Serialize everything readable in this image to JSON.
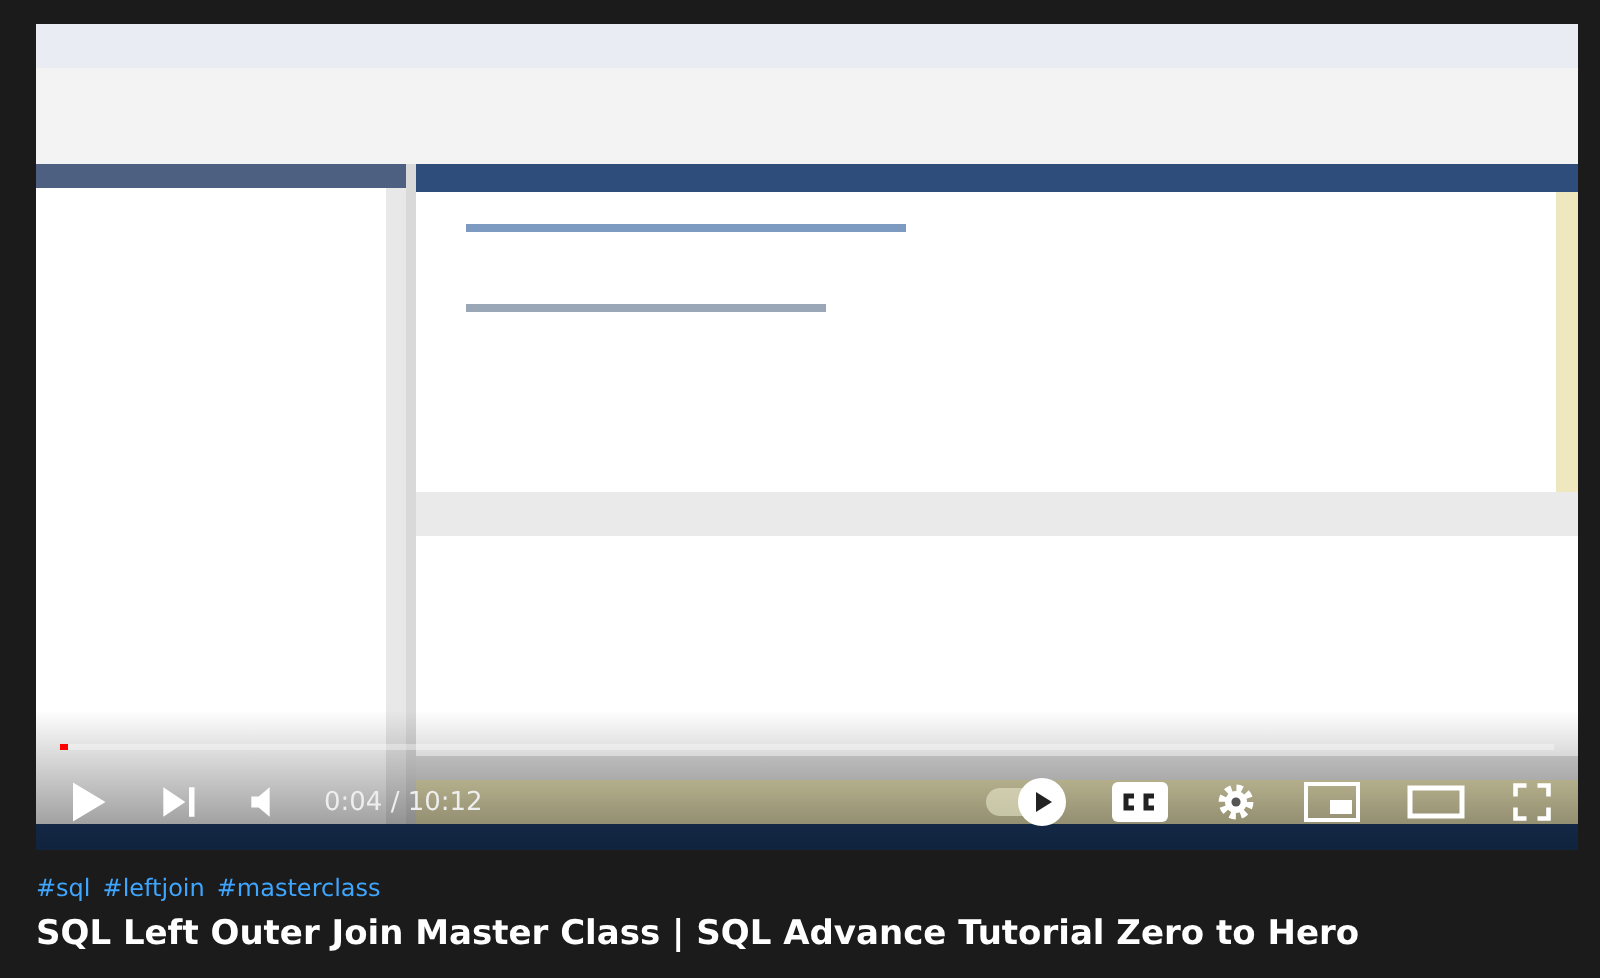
{
  "video": {
    "progress": {
      "level": 0.006
    },
    "time": "0:04 / 10:12",
    "autoplay": {
      "on": true
    }
  },
  "hashtags": [
    "#sql",
    "#leftjoin",
    "#masterclass"
  ],
  "title": "SQL Left Outer Join Master Class | SQL Advance Tutorial Zero to Hero"
}
